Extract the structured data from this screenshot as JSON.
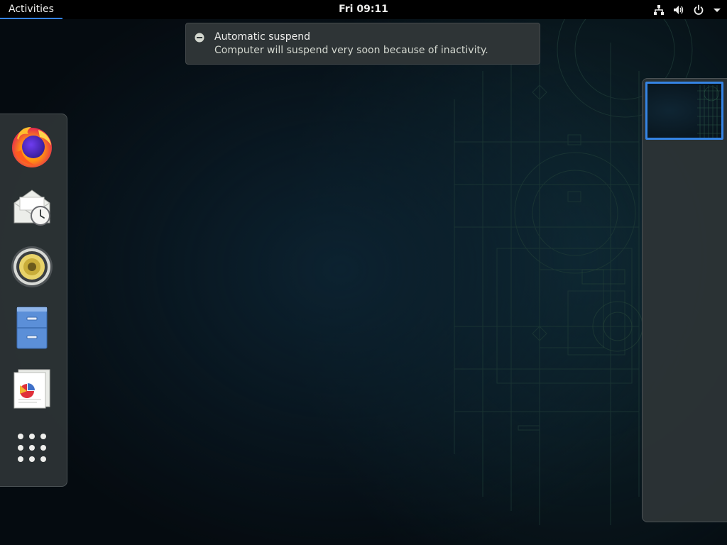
{
  "topbar": {
    "activities_label": "Activities",
    "clock": "Fri 09:11",
    "tray_icons": [
      "network-wired-icon",
      "volume-icon",
      "power-icon",
      "dropdown-arrow-icon"
    ]
  },
  "notification": {
    "icon": "minus-circle-icon",
    "title": "Automatic suspend",
    "body": "Computer will suspend very soon because of inactivity."
  },
  "dash": {
    "apps": [
      {
        "name": "firefox",
        "icon": "firefox-icon"
      },
      {
        "name": "evolution",
        "icon": "mail-clock-icon"
      },
      {
        "name": "rhythmbox",
        "icon": "speaker-icon"
      },
      {
        "name": "files",
        "icon": "file-cabinet-icon"
      },
      {
        "name": "libreoffice-impress",
        "icon": "document-chart-icon"
      },
      {
        "name": "show-applications",
        "icon": "app-grid-icon"
      }
    ]
  },
  "workspaces": {
    "count": 1,
    "active_index": 0
  },
  "colors": {
    "accent": "#3584e4",
    "panel": "#000000",
    "popup_bg": "#2e3436",
    "text": "#eeeeec"
  }
}
